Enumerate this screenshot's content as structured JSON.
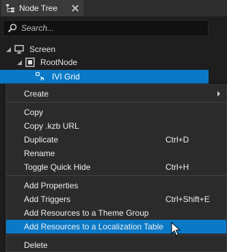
{
  "tab": {
    "title": "Node Tree"
  },
  "search": {
    "placeholder": "Search..."
  },
  "tree": [
    {
      "label": "Screen",
      "icon": "monitor-icon"
    },
    {
      "label": "RootNode",
      "icon": "square-node-icon"
    },
    {
      "label": "IVI Grid",
      "icon": "grid-node-icon"
    }
  ],
  "menu": {
    "create": "Create",
    "copy": "Copy",
    "copy_kzb": "Copy .kzb URL",
    "duplicate": "Duplicate",
    "duplicate_shortcut": "Ctrl+D",
    "rename": "Rename",
    "toggle_quick_hide": "Toggle Quick Hide",
    "toggle_quick_hide_shortcut": "Ctrl+H",
    "add_properties": "Add Properties",
    "add_triggers": "Add Triggers",
    "add_triggers_shortcut": "Ctrl+Shift+E",
    "add_resources_theme": "Add Resources to a Theme Group",
    "add_resources_localization": "Add Resources to a Localization Table",
    "delete": "Delete"
  },
  "colors": {
    "accent": "#0a7ac8",
    "background": "#1e1e1e",
    "menu_bg": "#2b2b2b"
  }
}
